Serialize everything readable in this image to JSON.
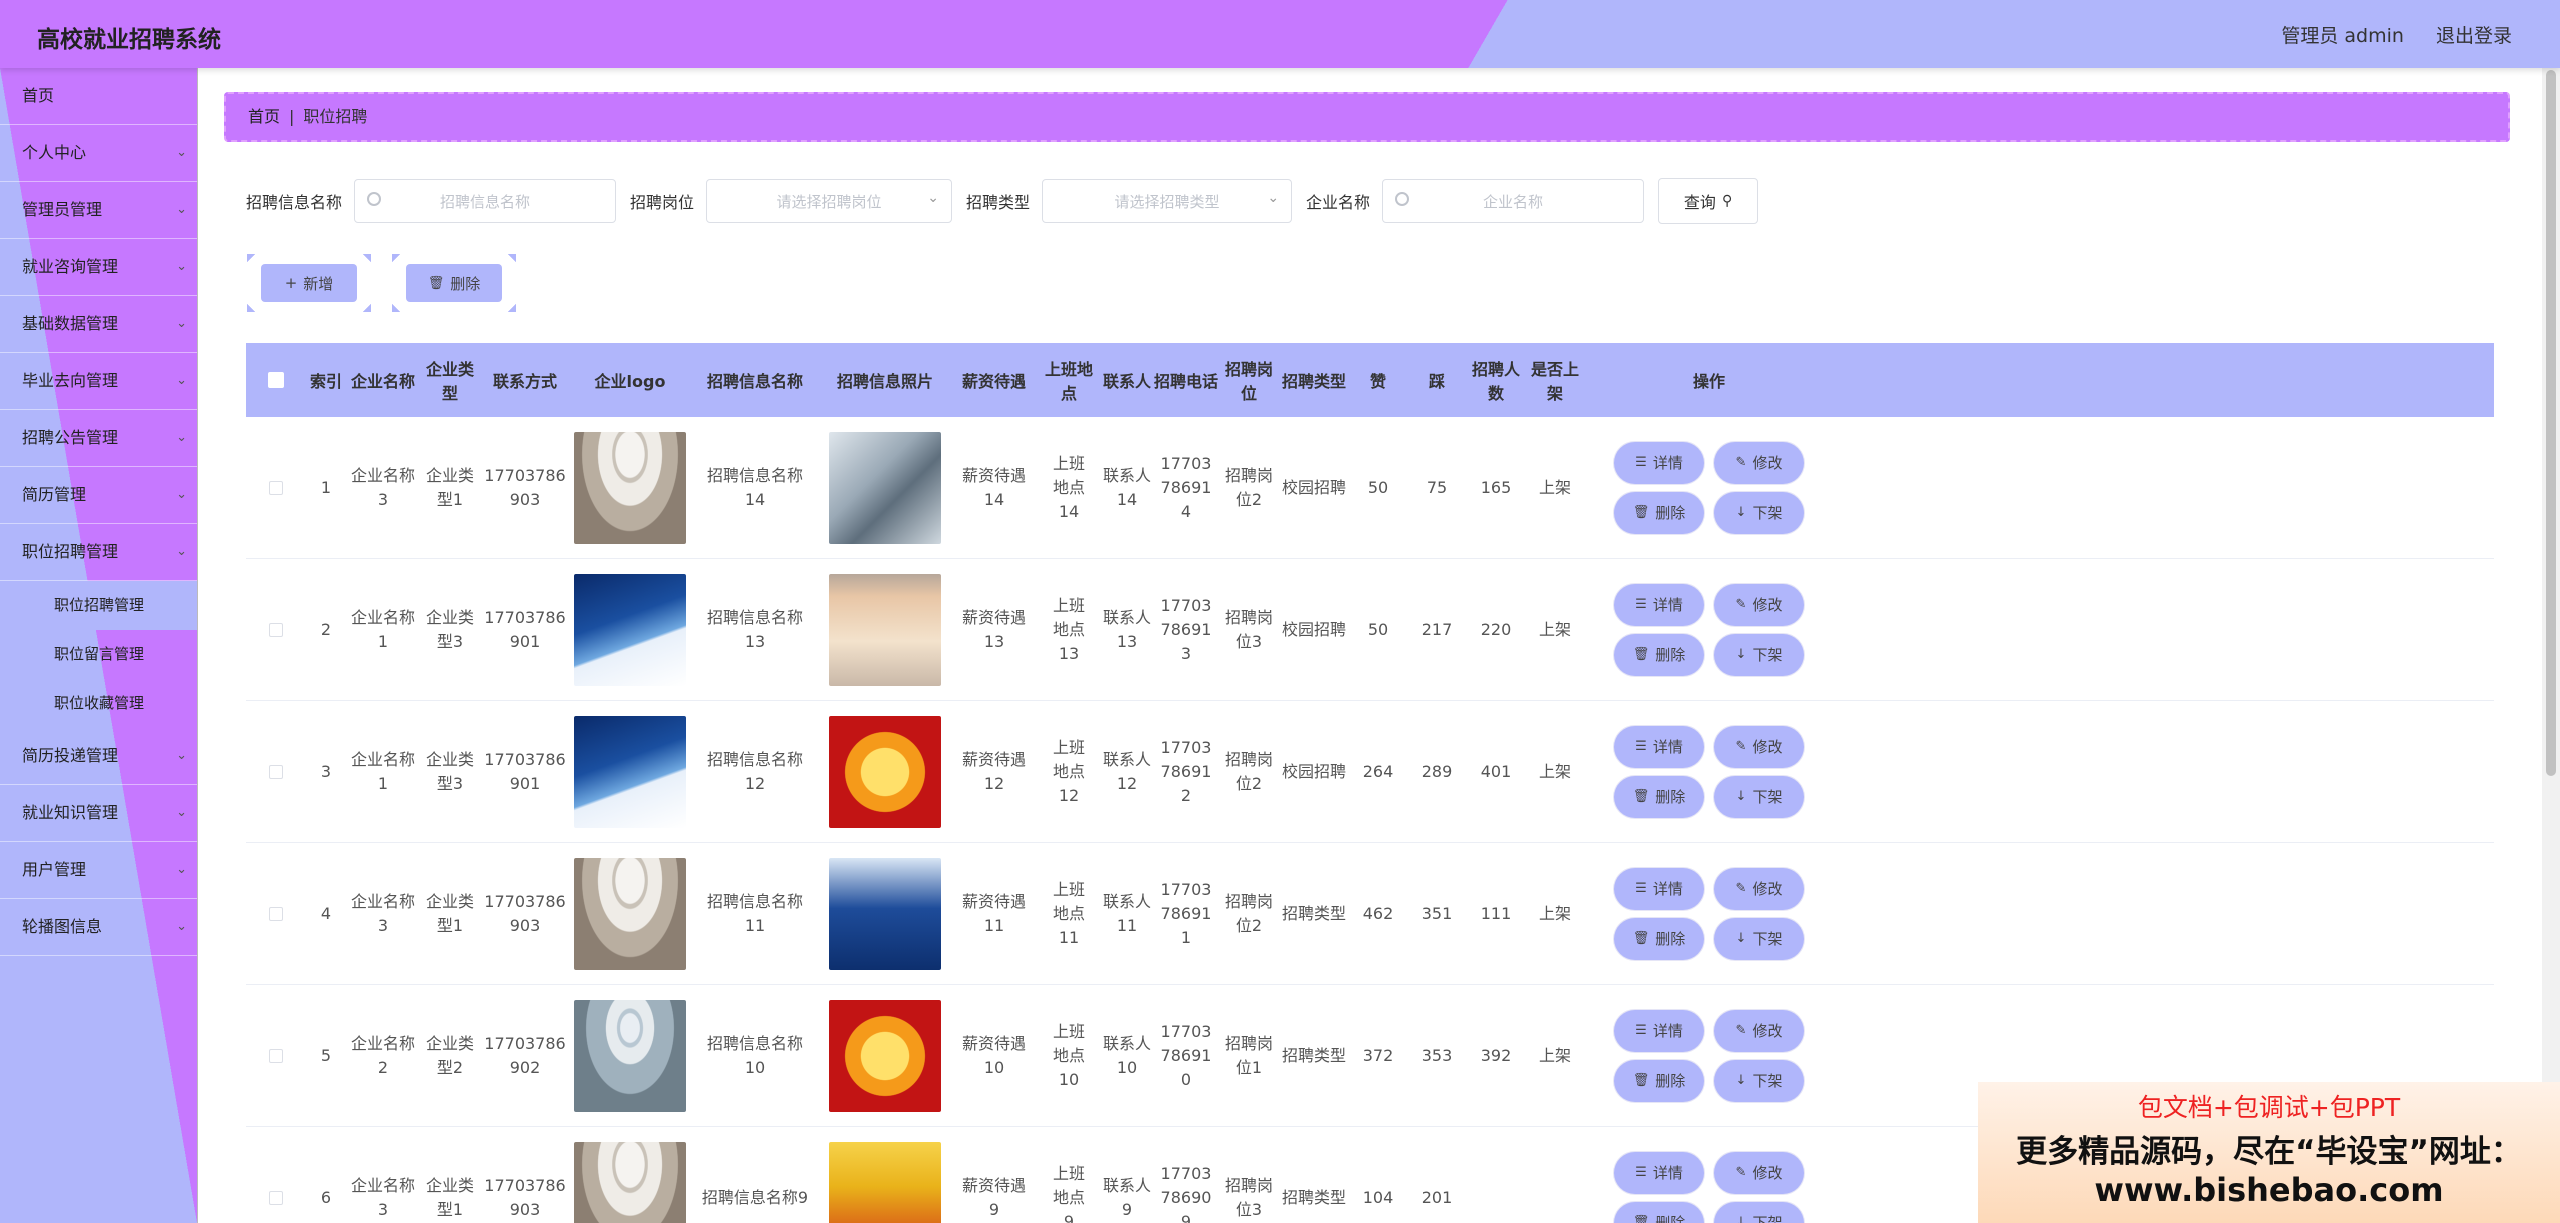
{
  "header": {
    "title": "高校就业招聘系统",
    "user": "管理员 admin",
    "logout": "退出登录"
  },
  "sidebar": {
    "items": [
      {
        "label": "首页",
        "chevron": false
      },
      {
        "label": "个人中心",
        "chevron": true
      },
      {
        "label": "管理员管理",
        "chevron": true
      },
      {
        "label": "就业咨询管理",
        "chevron": true
      },
      {
        "label": "基础数据管理",
        "chevron": true
      },
      {
        "label": "毕业去向管理",
        "chevron": true
      },
      {
        "label": "招聘公告管理",
        "chevron": true
      },
      {
        "label": "简历管理",
        "chevron": true
      },
      {
        "label": "职位招聘管理",
        "chevron": true,
        "open": true,
        "children": [
          "职位招聘管理",
          "职位留言管理",
          "职位收藏管理"
        ]
      },
      {
        "label": "简历投递管理",
        "chevron": true
      },
      {
        "label": "就业知识管理",
        "chevron": true
      },
      {
        "label": "用户管理",
        "chevron": true
      },
      {
        "label": "轮播图信息",
        "chevron": true
      }
    ]
  },
  "breadcrumb": {
    "home": "首页",
    "sep": "|",
    "current": "职位招聘"
  },
  "filters": {
    "f1_label": "招聘信息名称",
    "f1_placeholder": "招聘信息名称",
    "f2_label": "招聘岗位",
    "f2_placeholder": "请选择招聘岗位",
    "f3_label": "招聘类型",
    "f3_placeholder": "请选择招聘类型",
    "f4_label": "企业名称",
    "f4_placeholder": "企业名称",
    "query": "查询"
  },
  "actions": {
    "add": "新增",
    "delete": "删除"
  },
  "table": {
    "headers": [
      "索引",
      "企业名称",
      "企业类型",
      "联系方式",
      "企业logo",
      "招聘信息名称",
      "招聘信息照片",
      "薪资待遇",
      "上班地点",
      "联系人",
      "招聘电话",
      "招聘岗位",
      "招聘类型",
      "赞",
      "踩",
      "招聘人数",
      "是否上架",
      "操作"
    ],
    "rows": [
      {
        "idx": "1",
        "company": "企业名称3",
        "ctype": "企业类型1",
        "phone": "17703786903",
        "logo": "lobby",
        "name": "招聘信息名称14",
        "photo": "metal",
        "salary": "薪资待遇14",
        "place": "上班地点14",
        "contact": "联系人14",
        "tel": "17703786914",
        "post": "招聘岗位2",
        "rtype": "校园招聘",
        "like": "50",
        "dislike": "75",
        "num": "165",
        "shelf": "上架"
      },
      {
        "idx": "2",
        "company": "企业名称1",
        "ctype": "企业类型3",
        "phone": "17703786901",
        "logo": "brochure",
        "name": "招聘信息名称13",
        "photo": "poster",
        "salary": "薪资待遇13",
        "place": "上班地点13",
        "contact": "联系人13",
        "tel": "17703786913",
        "post": "招聘岗位3",
        "rtype": "校园招聘",
        "like": "50",
        "dislike": "217",
        "num": "220",
        "shelf": "上架"
      },
      {
        "idx": "3",
        "company": "企业名称1",
        "ctype": "企业类型3",
        "phone": "17703786901",
        "logo": "brochure",
        "name": "招聘信息名称12",
        "photo": "redgold",
        "salary": "薪资待遇12",
        "place": "上班地点12",
        "contact": "联系人12",
        "tel": "17703786912",
        "post": "招聘岗位2",
        "rtype": "校园招聘",
        "like": "264",
        "dislike": "289",
        "num": "401",
        "shelf": "上架"
      },
      {
        "idx": "4",
        "company": "企业名称3",
        "ctype": "企业类型1",
        "phone": "17703786903",
        "logo": "lobby",
        "name": "招聘信息名称11",
        "photo": "bluefair",
        "salary": "薪资待遇11",
        "place": "上班地点11",
        "contact": "联系人11",
        "tel": "17703786911",
        "post": "招聘岗位2",
        "rtype": "招聘类型",
        "like": "462",
        "dislike": "351",
        "num": "111",
        "shelf": "上架"
      },
      {
        "idx": "5",
        "company": "企业名称2",
        "ctype": "企业类型2",
        "phone": "17703786902",
        "logo": "office",
        "name": "招聘信息名称10",
        "photo": "redgold",
        "salary": "薪资待遇10",
        "place": "上班地点10",
        "contact": "联系人10",
        "tel": "17703786910",
        "post": "招聘岗位1",
        "rtype": "招聘类型",
        "like": "372",
        "dislike": "353",
        "num": "392",
        "shelf": "上架"
      },
      {
        "idx": "6",
        "company": "企业名称3",
        "ctype": "企业类型1",
        "phone": "17703786903",
        "logo": "lobby",
        "name": "招聘信息名称9",
        "photo": "yellowred",
        "salary": "薪资待遇9",
        "place": "上班地点9",
        "contact": "联系人9",
        "tel": "17703786909",
        "post": "招聘岗位3",
        "rtype": "招聘类型",
        "like": "104",
        "dislike": "201",
        "num": "",
        "shelf": ""
      }
    ],
    "ops": {
      "detail": "详情",
      "edit": "修改",
      "delete": "删除",
      "offshelf": "下架"
    }
  },
  "watermark": {
    "line1": "包文档+包调试+包PPT",
    "line2": "更多精品源码，尽在“毕设宝”网址：",
    "line3": "www.bishebao.com"
  },
  "colors": {
    "accent": "#c678ff",
    "secondary": "#b0b6fb"
  }
}
